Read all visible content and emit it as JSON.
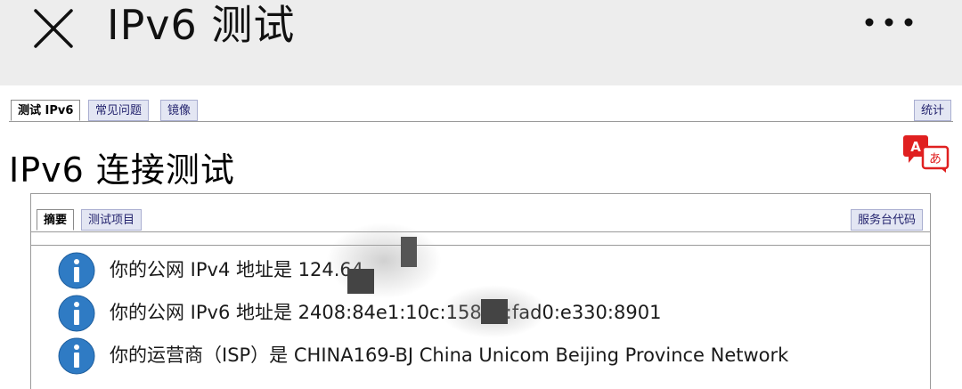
{
  "header": {
    "title": "IPv6 测试"
  },
  "nav": {
    "tabs": [
      "测试 IPv6",
      "常见问题",
      "镜像"
    ],
    "stats_label": "统计"
  },
  "page": {
    "title": "IPv6 连接测试"
  },
  "panel": {
    "tabs": [
      "摘要",
      "测试项目"
    ],
    "helpdesk_label": "服务台代码"
  },
  "results": [
    {
      "icon": "info-icon",
      "text": "你的公网 IPv4 地址是 124.64"
    },
    {
      "icon": "info-icon",
      "text": "你的公网 IPv6 地址是 2408:84e1:10c:1586:      :fad0:e330:8901"
    },
    {
      "icon": "info-icon",
      "text": "你的运营商（ISP）是 CHINA169-BJ China Unicom Beijing Province Network"
    }
  ],
  "colors": {
    "topbar": "#ededed",
    "tab_bg": "#e3e6f3",
    "tab_text": "#24246e",
    "info_blue": "#2f7bc4",
    "translate_red": "#e02020"
  }
}
